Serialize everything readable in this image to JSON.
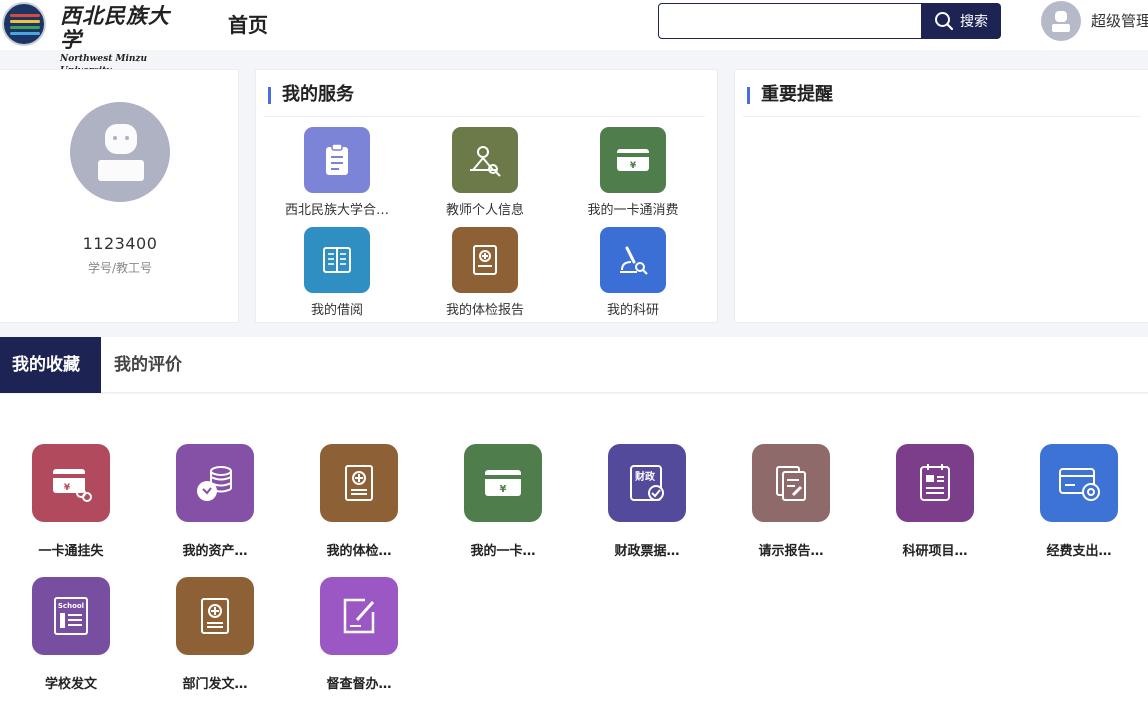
{
  "header": {
    "logo_cn": "西北民族大学",
    "logo_en": "Northwest Minzu University",
    "page_title": "首页",
    "search_placeholder": "",
    "search_button": "搜索",
    "user_name": "超级管理"
  },
  "profile": {
    "id": "1123400",
    "id_label": "学号/教工号"
  },
  "services": {
    "title": "我的服务",
    "items": [
      {
        "label": "西北民族大学合…",
        "icon": "clipboard-icon",
        "color": "#7b84d6"
      },
      {
        "label": "教师个人信息",
        "icon": "teacher-search-icon",
        "color": "#6b7a48"
      },
      {
        "label": "我的一卡通消费",
        "icon": "card-wallet-icon",
        "color": "#4f7e4c"
      },
      {
        "label": "我的借阅",
        "icon": "book-icon",
        "color": "#2f8fc2"
      },
      {
        "label": "我的体检报告",
        "icon": "medical-report-icon",
        "color": "#8e6035"
      },
      {
        "label": "我的科研",
        "icon": "microscope-icon",
        "color": "#3c6fd6"
      }
    ]
  },
  "reminders": {
    "title": "重要提醒"
  },
  "tabs": {
    "favorites": "我的收藏",
    "reviews": "我的评价"
  },
  "favorites": [
    {
      "label": "一卡通挂失",
      "icon": "card-lock-icon",
      "color": "#b24a5e"
    },
    {
      "label": "我的资产…",
      "icon": "coins-icon",
      "color": "#8451a6"
    },
    {
      "label": "我的体检…",
      "icon": "medical-report-icon",
      "color": "#8e6035"
    },
    {
      "label": "我的一卡…",
      "icon": "card-wallet-icon",
      "color": "#4f7e4c"
    },
    {
      "label": "财政票据…",
      "icon": "finance-check-icon",
      "color": "#534a9c"
    },
    {
      "label": "请示报告…",
      "icon": "document-edit-icon",
      "color": "#8f6a6a"
    },
    {
      "label": "科研项目…",
      "icon": "project-notebook-icon",
      "color": "#7c3d8a"
    },
    {
      "label": "经费支出…",
      "icon": "expense-card-icon",
      "color": "#3e73d6"
    },
    {
      "label": "学校发文",
      "icon": "school-doc-icon",
      "color": "#774ea0"
    },
    {
      "label": "部门发文…",
      "icon": "dept-doc-icon",
      "color": "#8e6035"
    },
    {
      "label": "督查督办…",
      "icon": "supervise-edit-icon",
      "color": "#9b58c4"
    }
  ],
  "icon_texts": {
    "yen": "¥",
    "finance": "财政",
    "school": "School"
  }
}
